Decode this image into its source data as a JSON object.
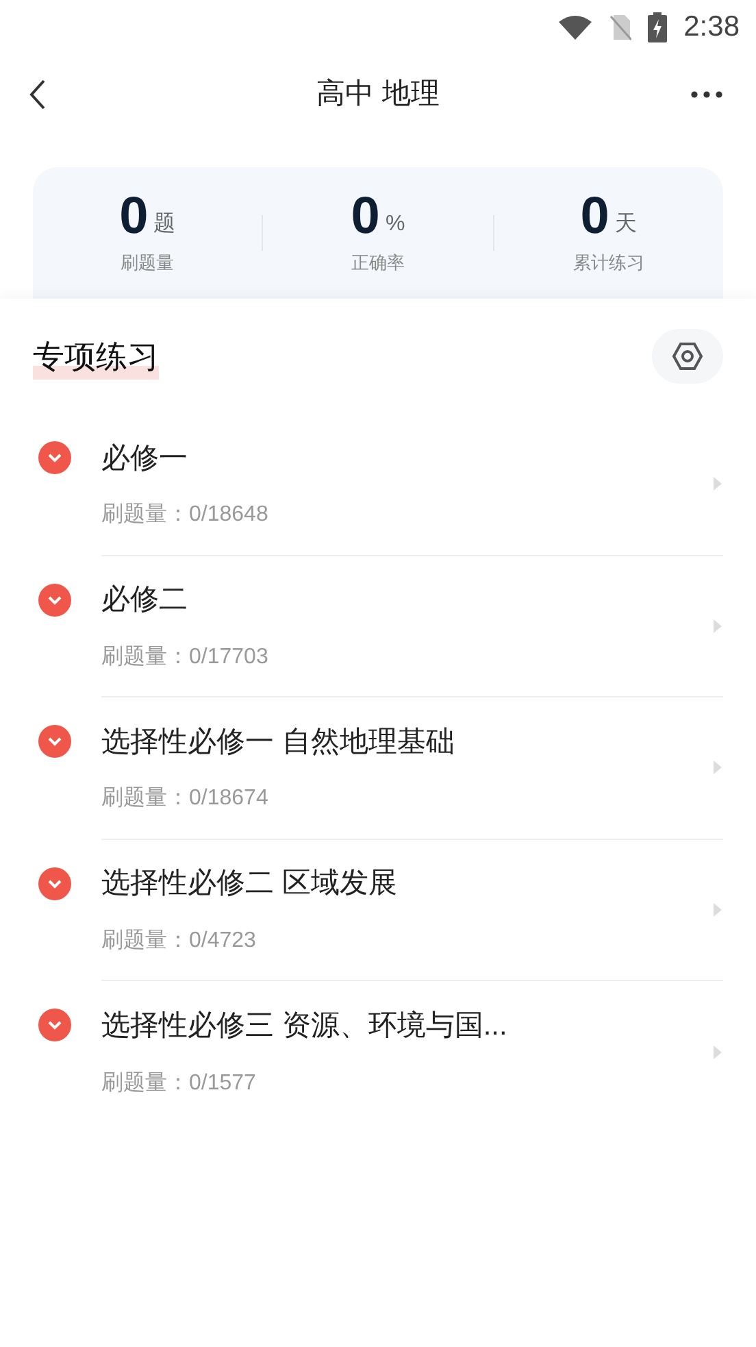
{
  "status_bar": {
    "time": "2:38"
  },
  "header": {
    "title": "高中 地理"
  },
  "stats": [
    {
      "value": "0",
      "unit": "题",
      "label": "刷题量"
    },
    {
      "value": "0",
      "unit": "%",
      "label": "正确率"
    },
    {
      "value": "0",
      "unit": "天",
      "label": "累计练习"
    }
  ],
  "section": {
    "title": "专项练习"
  },
  "chapters": [
    {
      "title": "必修一",
      "count": "刷题量：0/18648"
    },
    {
      "title": "必修二",
      "count": "刷题量：0/17703"
    },
    {
      "title": "选择性必修一 自然地理基础",
      "count": "刷题量：0/18674"
    },
    {
      "title": "选择性必修二 区域发展",
      "count": "刷题量：0/4723"
    },
    {
      "title": "选择性必修三 资源、环境与国...",
      "count": "刷题量：0/1577"
    }
  ]
}
